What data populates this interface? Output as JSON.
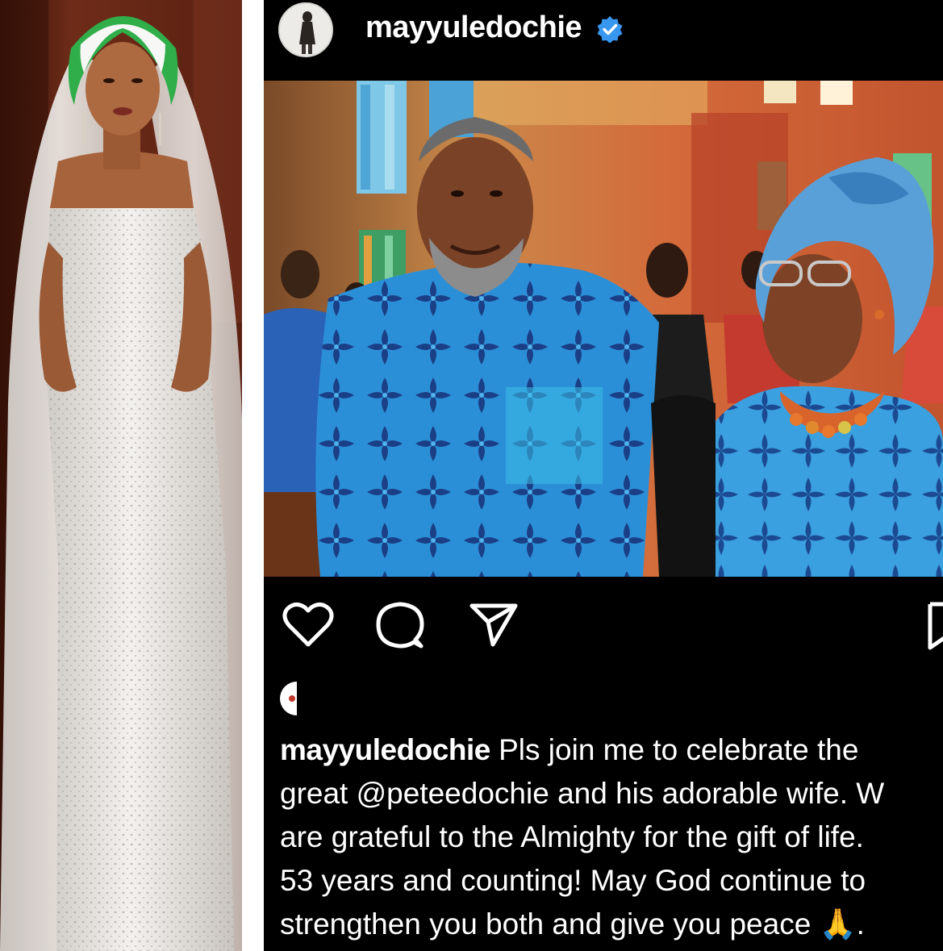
{
  "post": {
    "username": "mayyuledochie",
    "verified": true,
    "caption_lines": [
      "Pls join me to celebrate the",
      "great @peteedochie and his adorable wife. W",
      "are grateful to the Almighty for the gift of life.",
      "53 years and counting! May God continue to",
      "strengthen you both and give you peace 🙏."
    ],
    "actions": [
      "heart-icon",
      "comment-icon",
      "share-icon",
      "save-icon"
    ]
  },
  "colors": {
    "background": "#000000",
    "text": "#ffffff",
    "verified_blue": "#3897f0"
  }
}
